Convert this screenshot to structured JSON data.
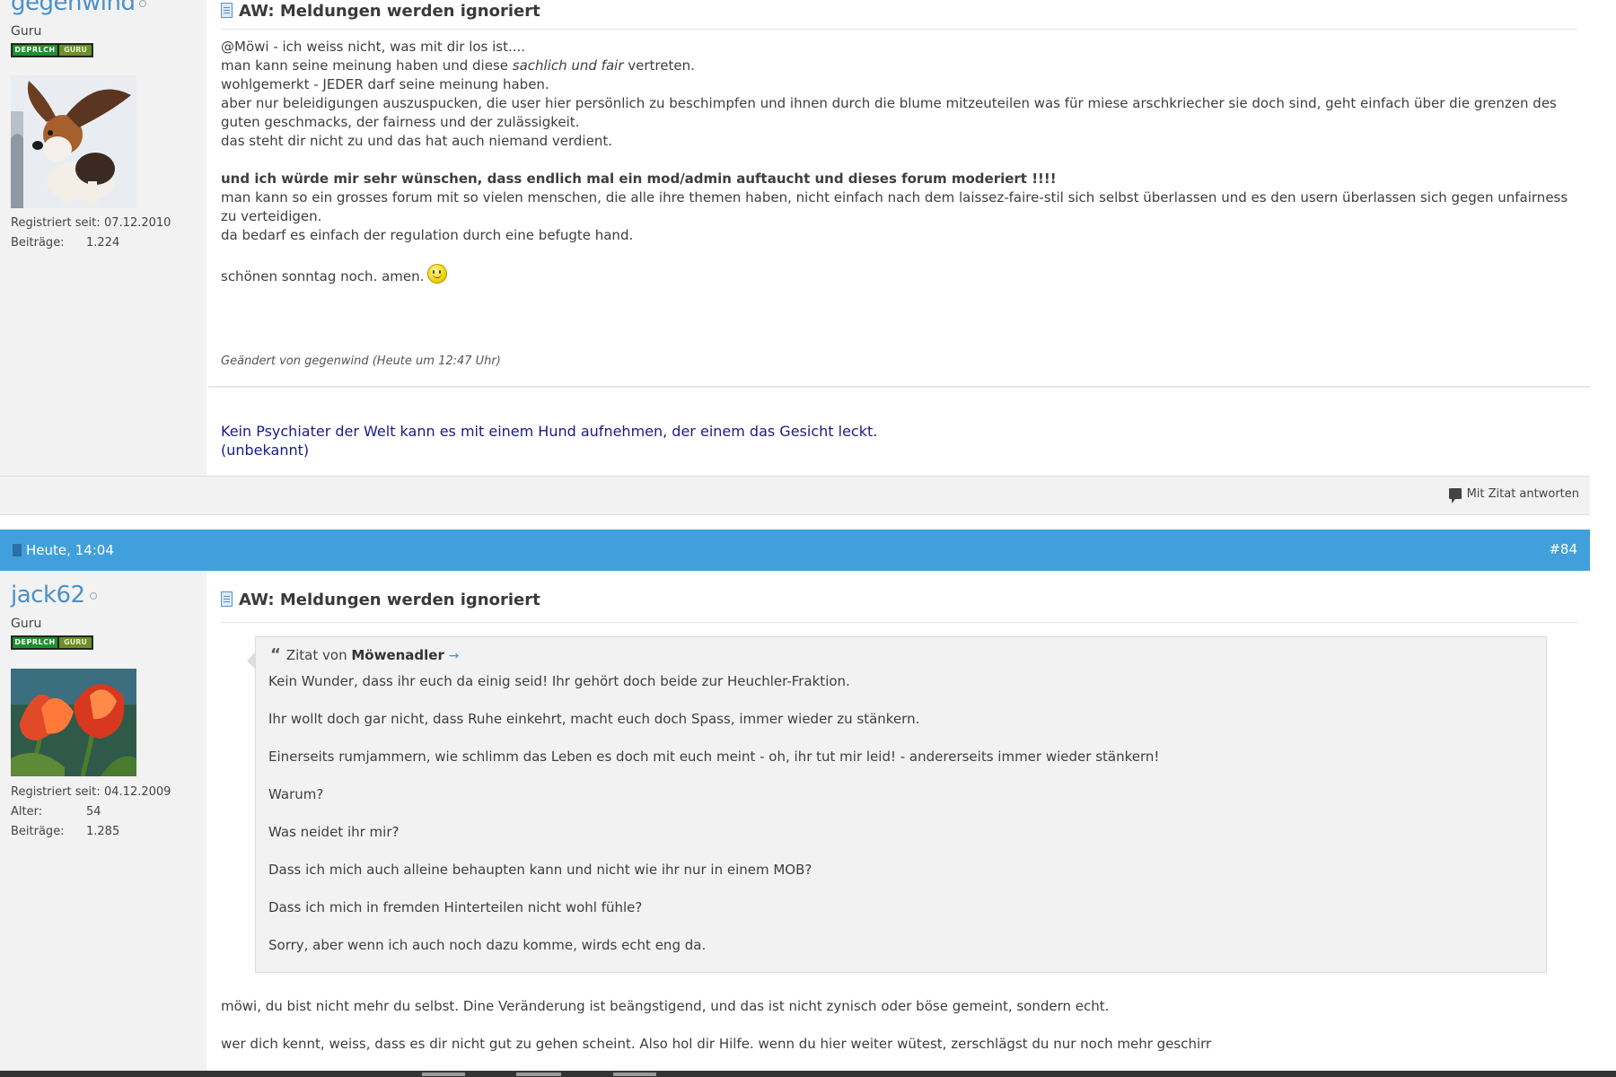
{
  "post1": {
    "username": "gegenwind",
    "rank": "Guru",
    "rank_bar": [
      "DEPRLCH",
      "GURU"
    ],
    "registered_label": "Registriert seit:",
    "registered_value": "07.12.2010",
    "posts_label": "Beiträge:",
    "posts_value": "1.224",
    "title": "AW: Meldungen werden ignoriert",
    "body": {
      "l1": "@Möwi - ich weiss nicht, was mit dir los ist....",
      "l2a": "man kann seine meinung haben und diese ",
      "l2b": "sachlich und fair",
      "l2c": " vertreten.",
      "l3": "wohlgemerkt - JEDER darf seine meinung haben.",
      "l4": "aber nur beleidigungen auszuspucken, die user hier persönlich zu beschimpfen und ihnen durch die blume mitzeuteilen was für miese arschkriecher sie doch sind, geht einfach über die grenzen des guten geschmacks, der fairness und der zulässigkeit.",
      "l5": "das steht dir nicht zu und das hat auch niemand verdient.",
      "l6": "und ich würde mir sehr wünschen, dass endlich mal ein mod/admin auftaucht und dieses forum moderiert !!!!",
      "l7": "man kann so ein grosses forum mit so vielen menschen, die alle ihre themen haben, nicht einfach nach dem laissez-faire-stil sich selbst überlassen und es den usern überlassen sich gegen unfairness zu verteidigen.",
      "l8": "da bedarf es einfach der regulation durch eine befugte hand.",
      "l9": "schönen sonntag noch. amen."
    },
    "edited": "Geändert von gegenwind (Heute um 12:47 Uhr)",
    "signature_l1": "Kein Psychiater der Welt kann es mit einem Hund aufnehmen, der einem das Gesicht leckt.",
    "signature_l2": "(unbekannt)",
    "reply_label": "Mit Zitat antworten"
  },
  "post2": {
    "date": "Heute, 14:04",
    "number": "#84",
    "username": "jack62",
    "rank": "Guru",
    "rank_bar": [
      "DEPRLCH",
      "GURU"
    ],
    "registered_label": "Registriert seit:",
    "registered_value": "04.12.2009",
    "age_label": "Alter:",
    "age_value": "54",
    "posts_label": "Beiträge:",
    "posts_value": "1.285",
    "title": "AW: Meldungen werden ignoriert",
    "quote": {
      "prefix": "Zitat von",
      "author": "Möwenadler",
      "lines": [
        "Kein Wunder, dass ihr euch da einig seid! Ihr gehört doch beide zur Heuchler-Fraktion.",
        "Ihr wollt doch gar nicht, dass Ruhe einkehrt, macht euch doch Spass, immer wieder zu stänkern.",
        "Einerseits rumjammern, wie schlimm das Leben es doch mit euch meint - oh, ihr tut mir leid! - andererseits immer wieder stänkern!",
        "Warum?",
        "Was neidet ihr mir?",
        "Dass ich mich auch alleine behaupten kann und nicht wie ihr nur in einem MOB?",
        "Dass ich mich in fremden Hinterteilen nicht wohl fühle?",
        "Sorry, aber wenn ich auch noch dazu komme, wirds echt eng da."
      ]
    },
    "body_l1": "möwi, du bist nicht mehr du selbst. Dine Veränderung ist beängstigend, und das ist nicht zynisch oder böse gemeint, sondern echt.",
    "body_l2": "wer dich kennt, weiss, dass es dir nicht gut zu gehen scheint. Also hol dir Hilfe. wenn du hier weiter wütest, zerschlägst du nur noch mehr geschirr"
  },
  "colors": {
    "accent": "#41a0dc",
    "username": "#4a90c8",
    "signature": "#1a1a8a",
    "sidebar": "#f2f2f2"
  },
  "icons": [
    "document-icon",
    "smiley-icon",
    "reply-quote-icon",
    "quote-mark-icon",
    "arrow-right-icon",
    "online-status-icon"
  ]
}
